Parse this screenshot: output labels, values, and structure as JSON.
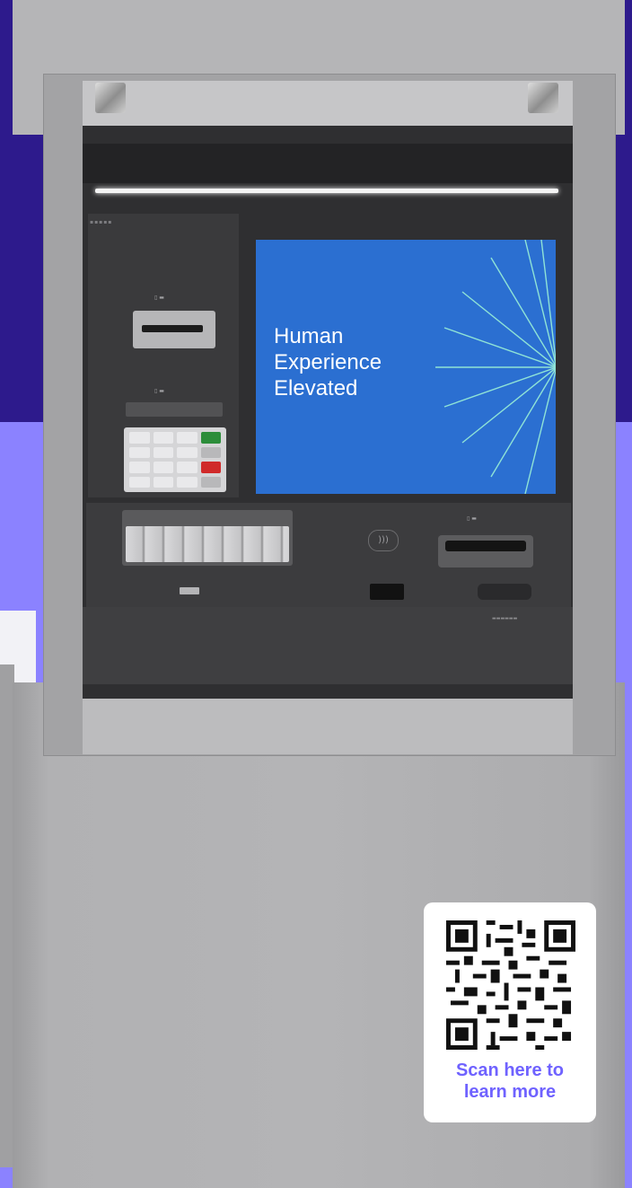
{
  "screen": {
    "line1": "Human",
    "line2": "Experience",
    "line3": "Elevated"
  },
  "qr_card": {
    "caption_line1": "Scan here to",
    "caption_line2": "learn more"
  },
  "colors": {
    "background_top": "#2d1a8c",
    "background_bottom": "#8b82ff",
    "screen_blue": "#2b6fd1",
    "caption_purple": "#6f62ff"
  },
  "icons": [
    "contactless-icon",
    "qr-code-icon"
  ]
}
